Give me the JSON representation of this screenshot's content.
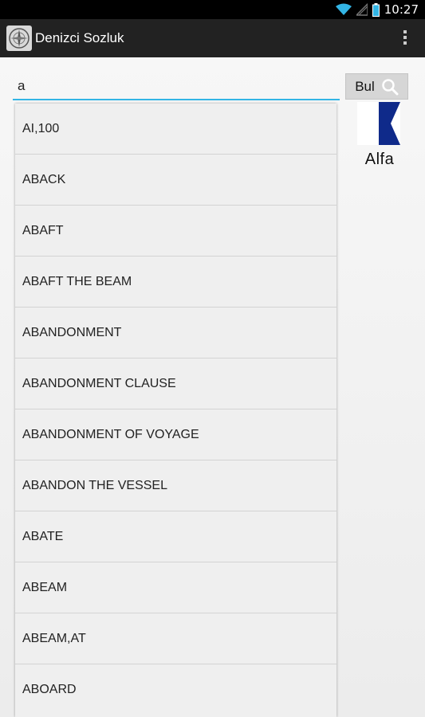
{
  "status_bar": {
    "time": "10:27",
    "icons": [
      "wifi-icon",
      "signal-icon",
      "battery-icon"
    ]
  },
  "action_bar": {
    "title": "Denizci Sozluk",
    "logo_icon": "compass-icon",
    "menu_icon": "overflow-menu-icon"
  },
  "search": {
    "value": "a",
    "button_label": "Bul",
    "button_icon": "search-icon",
    "accent_color": "#33b5e5"
  },
  "flag": {
    "label": "Alfa",
    "colors": [
      "#ffffff",
      "#0f2a8a"
    ]
  },
  "suggestions": [
    "AI,100",
    "ABACK",
    "ABAFT",
    "ABAFT THE BEAM",
    "ABANDONMENT",
    "ABANDONMENT CLAUSE",
    "ABANDONMENT OF VOYAGE",
    "ABANDON THE VESSEL",
    "ABATE",
    "ABEAM",
    "ABEAM,AT",
    "ABOARD"
  ]
}
